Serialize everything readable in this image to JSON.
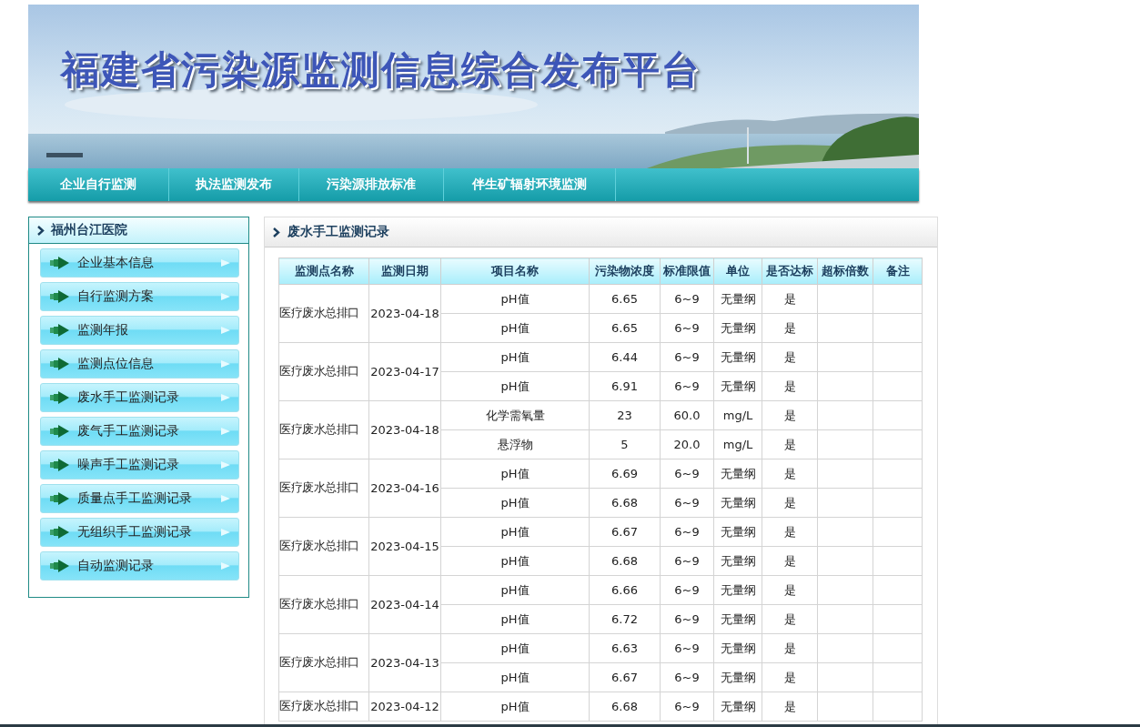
{
  "banner": {
    "title": "福建省污染源监测信息综合发布平台",
    "kind": "picture"
  },
  "nav": [
    {
      "label": "企业自行监测"
    },
    {
      "label": "执法监测发布"
    },
    {
      "label": "污染源排放标准"
    },
    {
      "label": "伴生矿辐射环境监测"
    }
  ],
  "sidebar": {
    "title": "福州台江医院",
    "items": [
      {
        "label": "企业基本信息"
      },
      {
        "label": "自行监测方案"
      },
      {
        "label": "监测年报"
      },
      {
        "label": "监测点位信息"
      },
      {
        "label": "废水手工监测记录"
      },
      {
        "label": "废气手工监测记录"
      },
      {
        "label": "噪声手工监测记录"
      },
      {
        "label": "质量点手工监测记录"
      },
      {
        "label": "无组织手工监测记录"
      },
      {
        "label": "自动监测记录"
      }
    ]
  },
  "panel": {
    "title": "废水手工监测记录",
    "table": {
      "columns": [
        "监测点名称",
        "监测日期",
        "项目名称",
        "污染物浓度",
        "标准限值",
        "单位",
        "是否达标",
        "超标倍数",
        "备注"
      ],
      "groups": [
        {
          "site": "医疗废水总排口",
          "date": "2023-04-18",
          "rows": [
            [
              "pH值",
              "6.65",
              "6~9",
              "无量纲",
              "是"
            ],
            [
              "pH值",
              "6.65",
              "6~9",
              "无量纲",
              "是"
            ]
          ]
        },
        {
          "site": "医疗废水总排口",
          "date": "2023-04-17",
          "rows": [
            [
              "pH值",
              "6.44",
              "6~9",
              "无量纲",
              "是"
            ],
            [
              "pH值",
              "6.91",
              "6~9",
              "无量纲",
              "是"
            ]
          ]
        },
        {
          "site": "医疗废水总排口",
          "date": "2023-04-18",
          "rows": [
            [
              "化学需氧量",
              "23",
              "60.0",
              "mg/L",
              "是"
            ],
            [
              "悬浮物",
              "5",
              "20.0",
              "mg/L",
              "是"
            ]
          ]
        },
        {
          "site": "医疗废水总排口",
          "date": "2023-04-16",
          "rows": [
            [
              "pH值",
              "6.69",
              "6~9",
              "无量纲",
              "是"
            ],
            [
              "pH值",
              "6.68",
              "6~9",
              "无量纲",
              "是"
            ]
          ]
        },
        {
          "site": "医疗废水总排口",
          "date": "2023-04-15",
          "rows": [
            [
              "pH值",
              "6.67",
              "6~9",
              "无量纲",
              "是"
            ],
            [
              "pH值",
              "6.68",
              "6~9",
              "无量纲",
              "是"
            ]
          ]
        },
        {
          "site": "医疗废水总排口",
          "date": "2023-04-14",
          "rows": [
            [
              "pH值",
              "6.66",
              "6~9",
              "无量纲",
              "是"
            ],
            [
              "pH值",
              "6.72",
              "6~9",
              "无量纲",
              "是"
            ]
          ]
        },
        {
          "site": "医疗废水总排口",
          "date": "2023-04-13",
          "rows": [
            [
              "pH值",
              "6.63",
              "6~9",
              "无量纲",
              "是"
            ],
            [
              "pH值",
              "6.67",
              "6~9",
              "无量纲",
              "是"
            ]
          ]
        },
        {
          "site": "医疗废水总排口",
          "date": "2023-04-12",
          "rows": [
            [
              "pH值",
              "6.68",
              "6~9",
              "无量纲",
              "是"
            ]
          ]
        }
      ]
    }
  }
}
